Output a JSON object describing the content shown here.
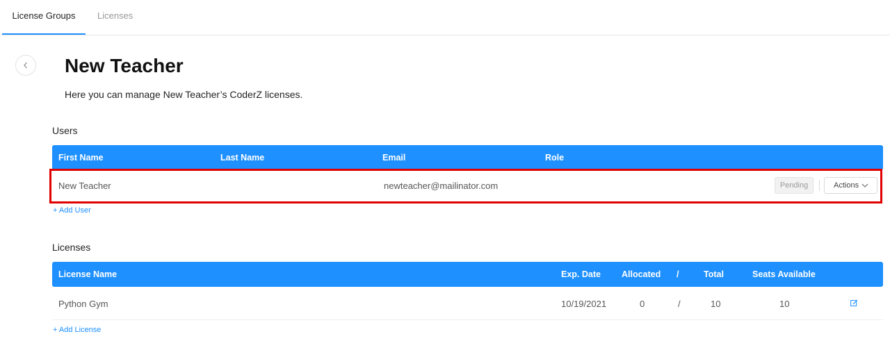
{
  "tabs": [
    {
      "label": "License Groups",
      "active": true
    },
    {
      "label": "Licenses",
      "active": false
    }
  ],
  "page": {
    "title": "New Teacher",
    "subtitle": "Here you can manage New Teacher’s CoderZ licenses."
  },
  "users": {
    "section_title": "Users",
    "columns": [
      "First Name",
      "Last Name",
      "Email",
      "Role"
    ],
    "rows": [
      {
        "first_name": "New Teacher",
        "last_name": "",
        "email": "newteacher@mailinator.com",
        "role": "",
        "status": "Pending",
        "actions_label": "Actions"
      }
    ],
    "add_label": "+ Add User"
  },
  "licenses": {
    "section_title": "Licenses",
    "columns": {
      "name": "License Name",
      "exp": "Exp. Date",
      "allocated": "Allocated",
      "slash": "/",
      "total": "Total",
      "seats": "Seats Available"
    },
    "rows": [
      {
        "name": "Python Gym",
        "exp": "10/19/2021",
        "allocated": "0",
        "slash": "/",
        "total": "10",
        "seats": "10"
      }
    ],
    "add_label": "+ Add License"
  },
  "colors": {
    "accent": "#1e90ff",
    "highlight": "#e00000"
  },
  "icons": {
    "back": "chevron-left-icon",
    "dropdown": "chevron-down-icon",
    "edit": "edit-icon"
  }
}
